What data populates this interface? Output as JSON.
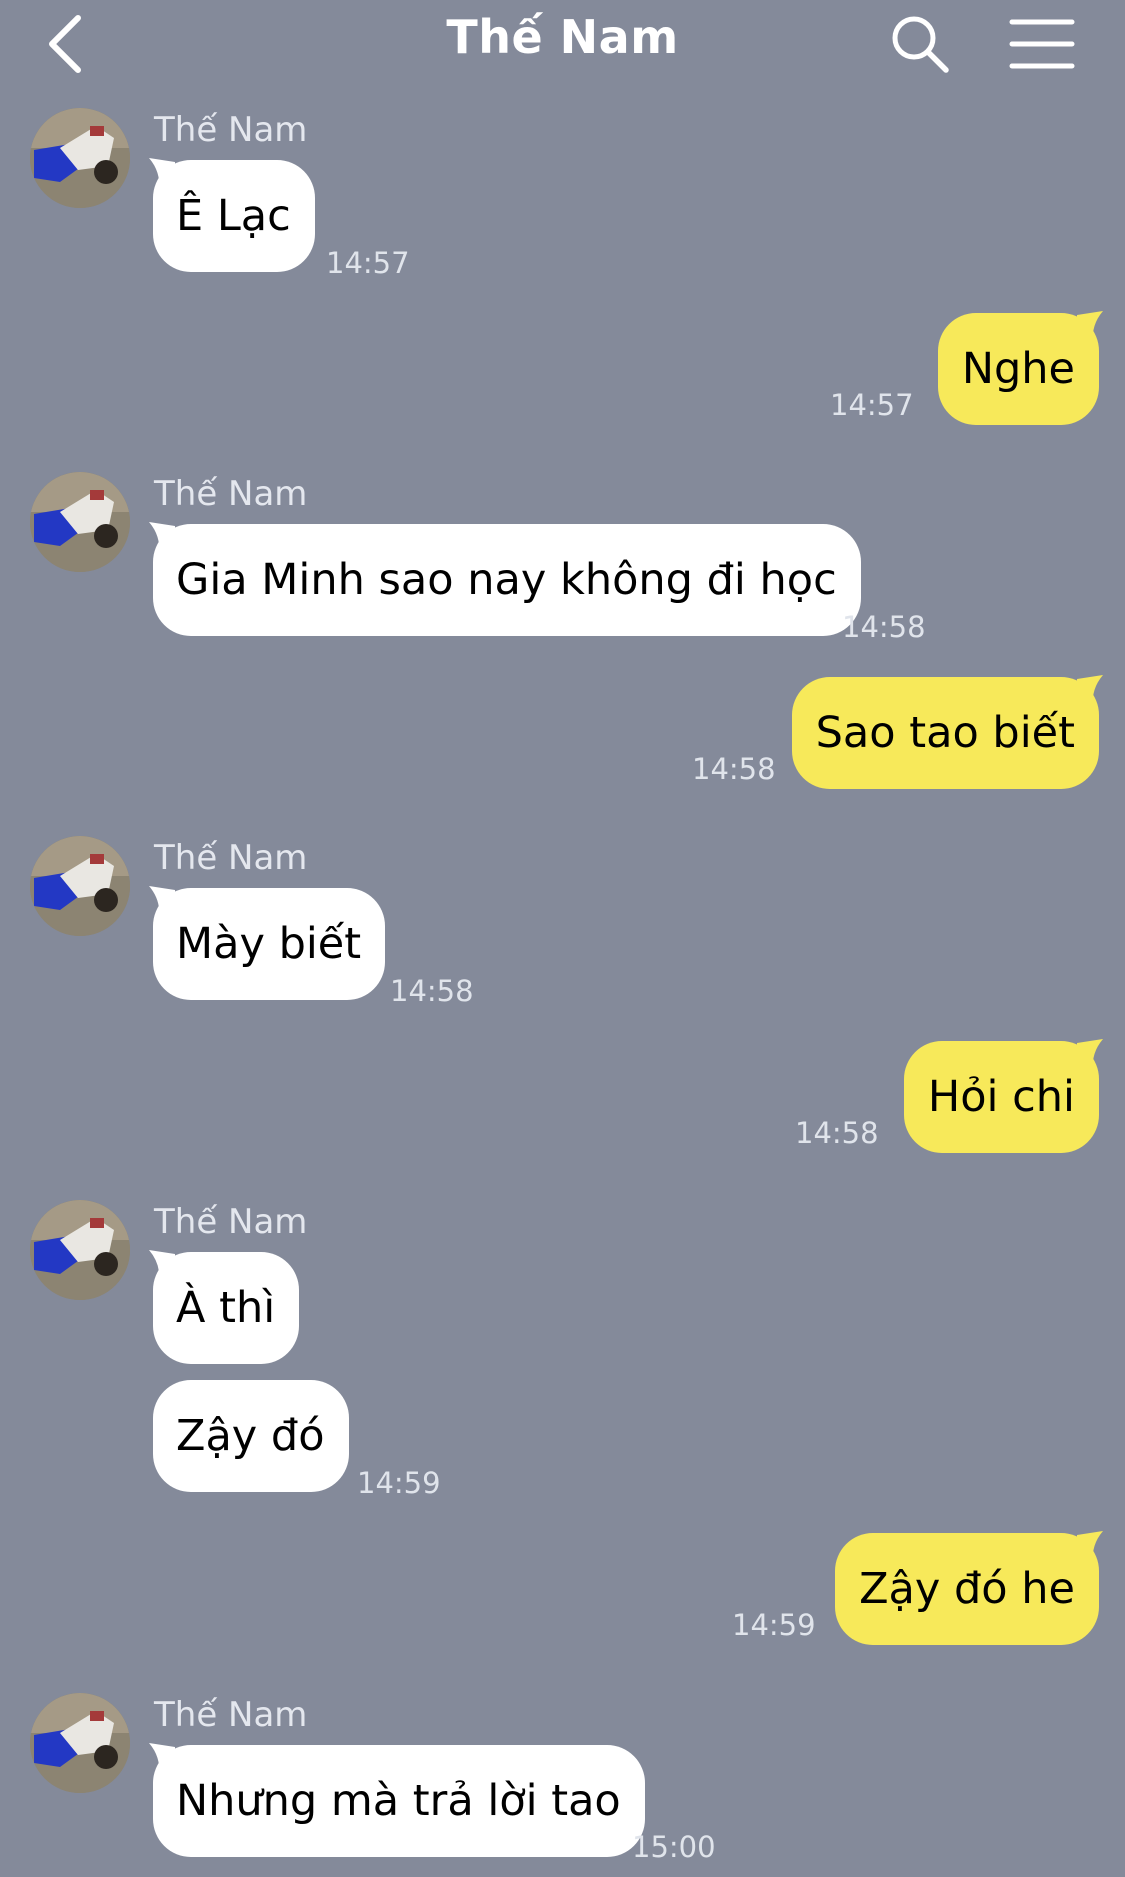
{
  "header": {
    "title": "Thế Nam"
  },
  "contact": {
    "name": "Thế Nam"
  },
  "messages": [
    {
      "direction": "in",
      "text": "Ê Lạc",
      "time": "14:57"
    },
    {
      "direction": "out",
      "text": "Nghe",
      "time": "14:57"
    },
    {
      "direction": "in",
      "text": "Gia Minh sao nay không đi học",
      "time": "14:58"
    },
    {
      "direction": "out",
      "text": "Sao tao biết",
      "time": "14:58"
    },
    {
      "direction": "in",
      "text": "Mày biết",
      "time": "14:58"
    },
    {
      "direction": "out",
      "text": "Hỏi chi",
      "time": "14:58"
    },
    {
      "direction": "in",
      "text": "À thì",
      "time": ""
    },
    {
      "direction": "in",
      "text": "Zậy đó",
      "time": "14:59"
    },
    {
      "direction": "out",
      "text": "Zậy đó he",
      "time": "14:59"
    },
    {
      "direction": "in",
      "text": "Nhưng mà trả lời tao",
      "time": "15:00"
    }
  ],
  "colors": {
    "background": "#848a9a",
    "incoming_bubble": "#ffffff",
    "outgoing_bubble": "#f7e95a"
  },
  "icons": {
    "back": "chevron-left-icon",
    "search": "search-icon",
    "menu": "hamburger-menu-icon"
  }
}
